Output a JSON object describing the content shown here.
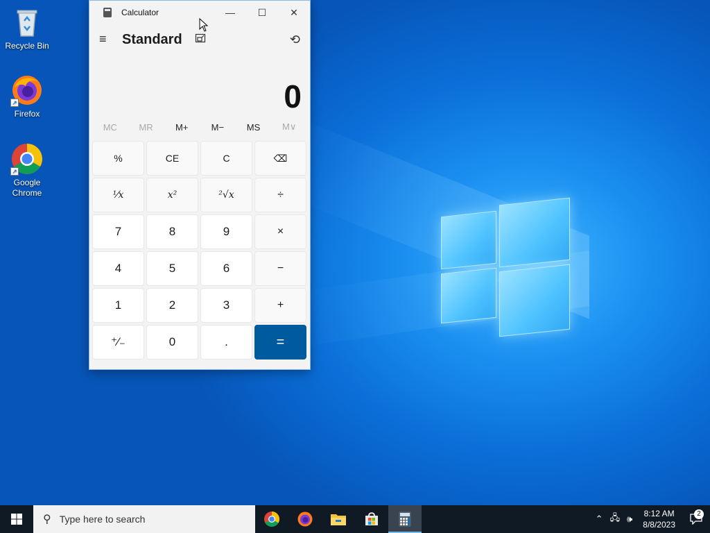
{
  "desktop": {
    "icons": [
      {
        "label": "Recycle Bin",
        "icon": "recycle-bin-icon"
      },
      {
        "label": "Firefox",
        "icon": "firefox-icon"
      },
      {
        "label": "Google Chrome",
        "icon": "chrome-icon"
      }
    ]
  },
  "calculator": {
    "window_title": "Calculator",
    "mode": "Standard",
    "display_value": "0",
    "memory_buttons": [
      {
        "label": "MC",
        "enabled": false
      },
      {
        "label": "MR",
        "enabled": false
      },
      {
        "label": "M+",
        "enabled": true
      },
      {
        "label": "M−",
        "enabled": true
      },
      {
        "label": "MS",
        "enabled": true
      },
      {
        "label": "M∨",
        "enabled": false
      }
    ],
    "keys": {
      "percent": "%",
      "ce": "CE",
      "clear": "C",
      "backspace": "⌫",
      "reciprocal": "¹⁄x",
      "square": "x²",
      "sqrt": "²√x",
      "divide": "÷",
      "seven": "7",
      "eight": "8",
      "nine": "9",
      "multiply": "×",
      "four": "4",
      "five": "5",
      "six": "6",
      "minus": "−",
      "one": "1",
      "two": "2",
      "three": "3",
      "plus": "+",
      "negate": "⁺⁄₋",
      "zero": "0",
      "decimal": ".",
      "equals": "="
    },
    "accent_color": "#005a9e"
  },
  "taskbar": {
    "search_placeholder": "Type here to search",
    "apps": [
      "chrome-icon",
      "firefox-icon",
      "file-explorer-icon",
      "store-icon",
      "calculator-icon"
    ],
    "active_app": "calculator-icon",
    "clock_time": "8:12 AM",
    "clock_date": "8/8/2023",
    "notification_count": "2"
  }
}
